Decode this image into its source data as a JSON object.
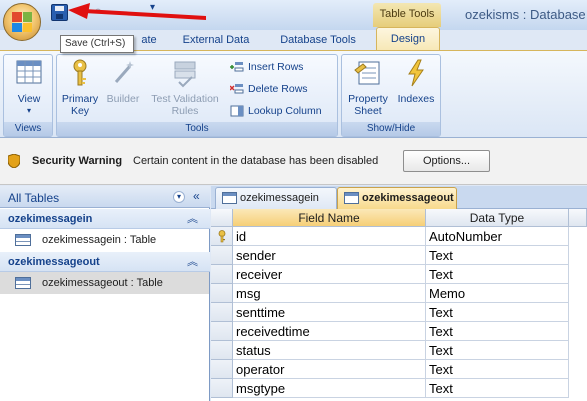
{
  "title_bar": {
    "app_title": "ozekisms : Database",
    "contextual_group": "Table Tools",
    "save_tooltip": "Save (Ctrl+S)"
  },
  "tabs": [
    {
      "label": "ate"
    },
    {
      "label": "External Data"
    },
    {
      "label": "Database Tools"
    },
    {
      "label": "Design",
      "active": true
    }
  ],
  "ribbon": {
    "groups": {
      "views": {
        "label": "Views",
        "view_button": "View"
      },
      "tools": {
        "label": "Tools",
        "primary_key": [
          "Primary",
          "Key"
        ],
        "builder": "Builder",
        "test_validation": [
          "Test Validation",
          "Rules"
        ],
        "insert_rows": "Insert Rows",
        "delete_rows": "Delete Rows",
        "lookup_column": "Lookup Column"
      },
      "showhide": {
        "label": "Show/Hide",
        "property_sheet": [
          "Property",
          "Sheet"
        ],
        "indexes": "Indexes"
      }
    }
  },
  "security_bar": {
    "title": "Security Warning",
    "message": "Certain content in the database has been disabled",
    "options_button": "Options..."
  },
  "nav_pane": {
    "title": "All Tables",
    "groups": [
      {
        "name": "ozekimessagein",
        "item": "ozekimessagein : Table"
      },
      {
        "name": "ozekimessageout",
        "item": "ozekimessageout : Table"
      }
    ]
  },
  "document_tabs": [
    {
      "label": "ozekimessagein",
      "active": false
    },
    {
      "label": "ozekimessageout",
      "active": true
    }
  ],
  "design_grid": {
    "headers": {
      "field_name": "Field Name",
      "data_type": "Data Type"
    },
    "rows": [
      {
        "field": "id",
        "type": "AutoNumber",
        "primary_key": true
      },
      {
        "field": "sender",
        "type": "Text"
      },
      {
        "field": "receiver",
        "type": "Text"
      },
      {
        "field": "msg",
        "type": "Memo"
      },
      {
        "field": "senttime",
        "type": "Text"
      },
      {
        "field": "receivedtime",
        "type": "Text"
      },
      {
        "field": "status",
        "type": "Text"
      },
      {
        "field": "operator",
        "type": "Text"
      },
      {
        "field": "msgtype",
        "type": "Text"
      }
    ]
  },
  "colors": {
    "ribbon_blue": "#dfe8f5",
    "design_tab_gold": "#f6e7b3",
    "annotation_arrow": "#e01010"
  }
}
